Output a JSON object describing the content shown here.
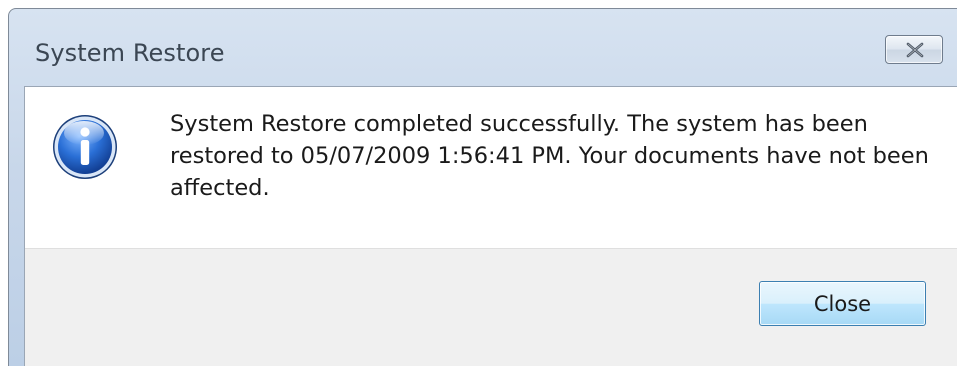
{
  "window": {
    "title": "System Restore"
  },
  "dialog": {
    "message": "System Restore completed successfully. The system has been\nrestored to 05/07/2009 1:56:41 PM. Your documents have not been\naffected.",
    "icon": "info-icon"
  },
  "footer": {
    "close_label": "Close"
  },
  "colors": {
    "titlebar": "#c8d7ea",
    "button_border": "#3c7fb1",
    "button_fill": "#bee6fd",
    "footer": "#f0f0f0",
    "info_icon": "#1f5fbf"
  }
}
